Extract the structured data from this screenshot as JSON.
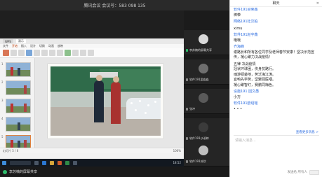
{
  "meeting": {
    "title": "腾讯会议 会议号：583 098 135"
  },
  "wps": {
    "tabs": [
      "WPS",
      "演示"
    ],
    "menu": [
      "文件",
      "开始",
      "插入",
      "设计",
      "切换",
      "动画",
      "放映"
    ],
    "status_left": "幻灯片 5 / 6",
    "status_right": "100%"
  },
  "slides": [
    1,
    2,
    3,
    4,
    5
  ],
  "taskbar": {
    "time": "18:52"
  },
  "share": {
    "label": "李苏楠的屏幕共享"
  },
  "participants": [
    {
      "name": "李苏楠的屏幕共享"
    },
    {
      "name": "软件191梁淼淼"
    },
    {
      "name": "张冲"
    },
    {
      "name": "软件191沙淑婷"
    },
    {
      "name": "软件191苏欣"
    }
  ],
  "chat": {
    "title": "聊天",
    "close": "✕",
    "messages": [
      {
        "sender": "软件191梁荣鑫",
        "text": "棒带"
      },
      {
        "sender": "网络191杜汶柏",
        "text": ""
      },
      {
        "sender": "",
        "text": "ximu"
      },
      {
        "sender": "软件191赵宇鑫",
        "text": "哦哦"
      },
      {
        "sender": "齐海峰",
        "text": "谢路长和所有各位同学及老师春节安康！坚决示范宣传，凝心聚力决战疫情！"
      },
      {
        "sender": "",
        "text": "五律  决战疫情\n冠状环球困，伤身抗路行。\n魂游鄂楚地，势泛海江涛。\n宜鸭先学势，坚聚回医咽。\n凝心聚智灯，赛鹏同梅色。"
      },
      {
        "sender": "设施191 回文愚",
        "text": "小万"
      },
      {
        "sender": "软件191欧绍瑶",
        "text": "• • •"
      }
    ],
    "more_link": "查看更多消息 >",
    "input_placeholder": "请输入消息...",
    "send_to": "发送给 所有人"
  }
}
